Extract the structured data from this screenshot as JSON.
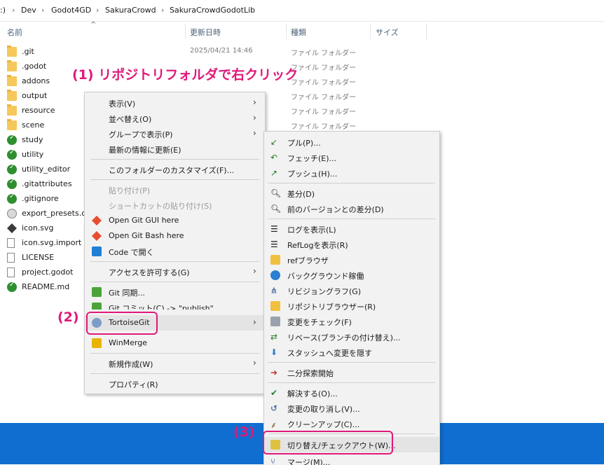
{
  "breadcrumb": {
    "drive": ":)",
    "parts": [
      "Dev",
      "Godot4GD",
      "SakuraCrowd",
      "SakuraCrowdGodotLib"
    ]
  },
  "columns": {
    "name": "名前",
    "modified": "更新日時",
    "type": "種類",
    "size": "サイズ"
  },
  "files": [
    {
      "name": ".git",
      "date": "2025/04/21 14:46",
      "type": "ファイル フォルダー",
      "icon": "folder-icon"
    },
    {
      "name": ".godot",
      "date": "",
      "type": "ファイル フォルダー",
      "icon": "folder-icon"
    },
    {
      "name": "addons",
      "date": "",
      "type": "ファイル フォルダー",
      "icon": "folder-icon"
    },
    {
      "name": "output",
      "date": "",
      "type": "ファイル フォルダー",
      "icon": "folder-icon"
    },
    {
      "name": "resource",
      "date": "",
      "type": "ファイル フォルダー",
      "icon": "folder-icon"
    },
    {
      "name": "scene",
      "date": "",
      "type": "ファイル フォルダー",
      "icon": "folder-icon"
    },
    {
      "name": "study",
      "date": "",
      "type": "",
      "icon": "git-folder-icon"
    },
    {
      "name": "utility",
      "date": "",
      "type": "",
      "icon": "git-folder-icon"
    },
    {
      "name": "utility_editor",
      "date": "",
      "type": "",
      "icon": "git-folder-icon"
    },
    {
      "name": ".gitattributes",
      "date": "",
      "type": "",
      "icon": "git-file-icon"
    },
    {
      "name": ".gitignore",
      "date": "",
      "type": "",
      "icon": "git-file-icon"
    },
    {
      "name": "export_presets.cfg",
      "date": "",
      "type": "",
      "icon": "config-file-icon"
    },
    {
      "name": "icon.svg",
      "date": "",
      "type": "",
      "icon": "svg-file-icon"
    },
    {
      "name": "icon.svg.import",
      "date": "",
      "type": "",
      "icon": "file-icon"
    },
    {
      "name": "LICENSE",
      "date": "",
      "type": "",
      "icon": "file-icon"
    },
    {
      "name": "project.godot",
      "date": "",
      "type": "",
      "icon": "file-icon"
    },
    {
      "name": "README.md",
      "date": "",
      "type": "",
      "icon": "git-file-icon"
    }
  ],
  "context_menu": {
    "view": "表示(V)",
    "sort": "並べ替え(O)",
    "group": "グループで表示(P)",
    "refresh": "最新の情報に更新(E)",
    "customize": "このフォルダーのカスタマイズ(F)...",
    "paste": "貼り付け(P)",
    "paste_shortcut": "ショートカットの貼り付け(S)",
    "git_gui": "Open Git GUI here",
    "git_bash": "Open Git Bash here",
    "code": "Code で開く",
    "access": "アクセスを許可する(G)",
    "git_sync": "Git 同期...",
    "git_commit": "Git コミット(C) -> \"publish\"...",
    "tortoisegit": "TortoiseGit",
    "winmerge": "WinMerge",
    "new": "新規作成(W)",
    "properties": "プロパティ(R)"
  },
  "submenu": {
    "pull": "プル(P)...",
    "fetch": "フェッチ(E)...",
    "push": "プッシュ(H)...",
    "diff": "差分(D)",
    "diff_prev": "前のバージョンとの差分(D)",
    "log": "ログを表示(L)",
    "reflog": "RefLogを表示(R)",
    "refbrowser": "refブラウザ",
    "daemon": "バックグラウンド稼働",
    "revgraph": "リビジョングラフ(G)",
    "repobrowser": "リポジトリブラウザー(R)",
    "checkmods": "変更をチェック(F)",
    "rebase": "リベース(ブランチの付け替え)...",
    "stash": "スタッシュへ変更を隠す",
    "bisect": "二分探索開始",
    "resolve": "解決する(O)...",
    "revert": "変更の取り消し(V)...",
    "cleanup": "クリーンアップ(C)...",
    "switch": "切り替え/チェックアウト(W)...",
    "merge": "マージ(M)..."
  },
  "annotations": {
    "step1": "(1) リポジトリフォルダで右クリック",
    "step2": "(2)",
    "step3": "(3)",
    "color": "#e0197a"
  }
}
